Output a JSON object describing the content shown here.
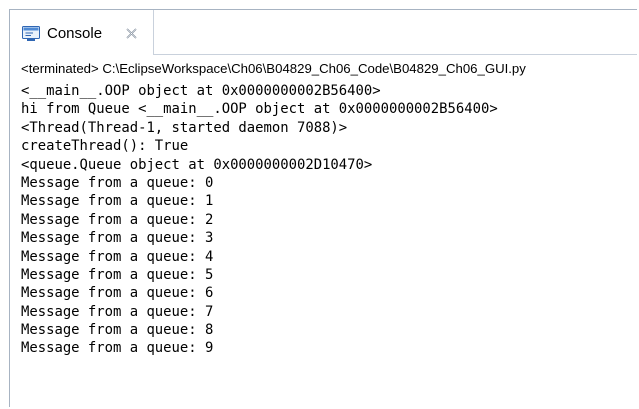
{
  "console_tab": {
    "label": "Console",
    "icon": "console-icon",
    "close_icon": "close-icon"
  },
  "status": "<terminated> C:\\EclipseWorkspace\\Ch06\\B04829_Ch06_Code\\B04829_Ch06_GUI.py",
  "output_lines": [
    "<__main__.OOP object at 0x0000000002B56400>",
    "hi from Queue <__main__.OOP object at 0x0000000002B56400>",
    "<Thread(Thread-1, started daemon 7088)>",
    "createThread(): True",
    "<queue.Queue object at 0x0000000002D10470>",
    "Message from a queue: 0",
    "Message from a queue: 1",
    "Message from a queue: 2",
    "Message from a queue: 3",
    "Message from a queue: 4",
    "Message from a queue: 5",
    "Message from a queue: 6",
    "Message from a queue: 7",
    "Message from a queue: 8",
    "Message from a queue: 9"
  ]
}
